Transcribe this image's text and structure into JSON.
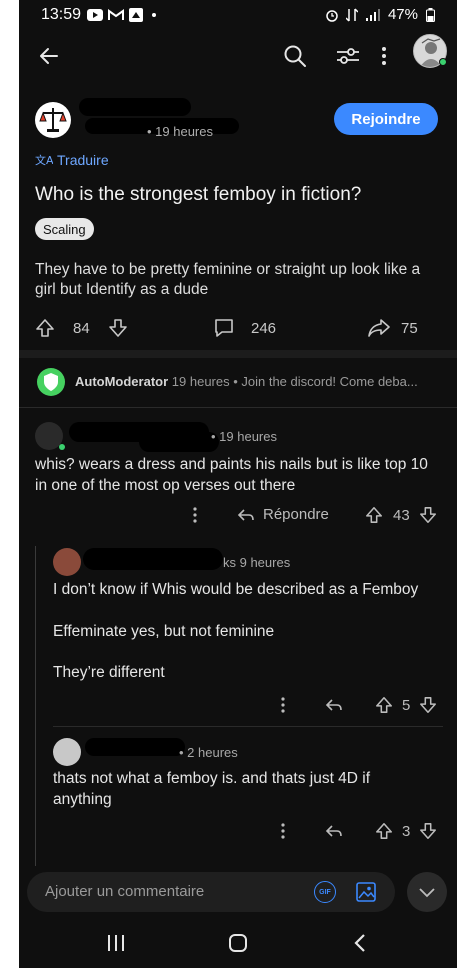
{
  "status_bar": {
    "time": "13:59",
    "battery": "47%"
  },
  "post": {
    "time": "19 heures",
    "join_label": "Rejoindre",
    "translate_label": "Traduire",
    "title": "Who is the strongest femboy in fiction?",
    "flair": "Scaling",
    "body": "They have to be pretty feminine or straight up look like a girl but Identify as a dude",
    "upvotes": "84",
    "comments": "246",
    "shares": "75"
  },
  "automod": {
    "name": "AutoModerator",
    "meta": " 19 heures • Join the discord! Come deba..."
  },
  "comments": [
    {
      "time": "19 heures",
      "text": "whis? wears a dress and paints his nails but is like top 10 in one of the most op verses out there",
      "reply_label": "Répondre",
      "votes": "43"
    },
    {
      "time": "ks 9 heures",
      "paragraphs": [
        "I don’t know if Whis would be described as a Femboy",
        "Effeminate yes, but not feminine",
        "They’re different"
      ],
      "votes": "5"
    },
    {
      "time": "2 heures",
      "text": "thats not what a femboy is. and thats just 4D if anything",
      "votes": "3"
    }
  ],
  "composer": {
    "placeholder": "Ajouter un commentaire",
    "gif_label": "GIF"
  },
  "colors": {
    "accent": "#3b89ff",
    "background": "#0f0f0f",
    "online": "#3bd16f",
    "automod": "#46d160"
  }
}
